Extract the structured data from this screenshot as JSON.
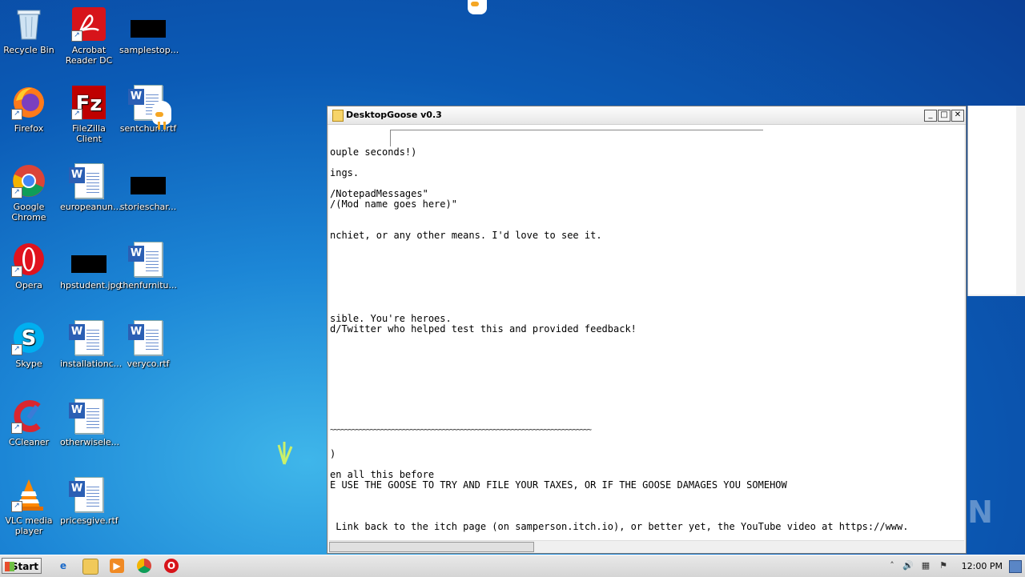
{
  "desktop": {
    "icons": [
      {
        "label": "Recycle Bin"
      },
      {
        "label": "Acrobat Reader DC"
      },
      {
        "label": "samplestop..."
      },
      {
        "label": "Firefox"
      },
      {
        "label": "FileZilla Client"
      },
      {
        "label": "sentchur...rtf"
      },
      {
        "label": "Google Chrome"
      },
      {
        "label": "europeanun..."
      },
      {
        "label": "storieschar..."
      },
      {
        "label": "Opera"
      },
      {
        "label": "hpstudent.jpg"
      },
      {
        "label": "thenfurnitu..."
      },
      {
        "label": "Skype"
      },
      {
        "label": "installationc..."
      },
      {
        "label": "veryco.rtf"
      },
      {
        "label": "CCleaner"
      },
      {
        "label": "otherwisele..."
      },
      {
        "label": "VLC media player"
      },
      {
        "label": "pricesgive.rtf"
      }
    ],
    "watermark": "ANY RUN"
  },
  "window": {
    "title": "DesktopGoose v0.3",
    "buttons": {
      "minimize": "_",
      "maximize": "□",
      "close": "✕"
    },
    "lines": [
      "ouple seconds!)",
      "ings.",
      "/NotepadMessages\"",
      "/(Mod name goes here)\"",
      "nchiet, or any other means. I'd love to see it.",
      "sible. You're heroes.",
      "d/Twitter who helped test this and provided feedback!",
      "~~~~~~~~~~~~~~~~~~~~~~~~~~~~~~~~~~~~~~~~~~~~~~~~~~~~~~~~~~~~~~~~~~~~~~~~",
      ")",
      "en all this before",
      "E USE THE GOOSE TO TRY AND FILE YOUR TAXES, OR IF THE GOOSE DAMAGES YOU SOMEHOW",
      " Link back to the itch page (on samperson.itch.io), or better yet, the YouTube video at https://www."
    ]
  },
  "taskbar": {
    "start_label": "Start",
    "clock": "12:00 PM"
  }
}
